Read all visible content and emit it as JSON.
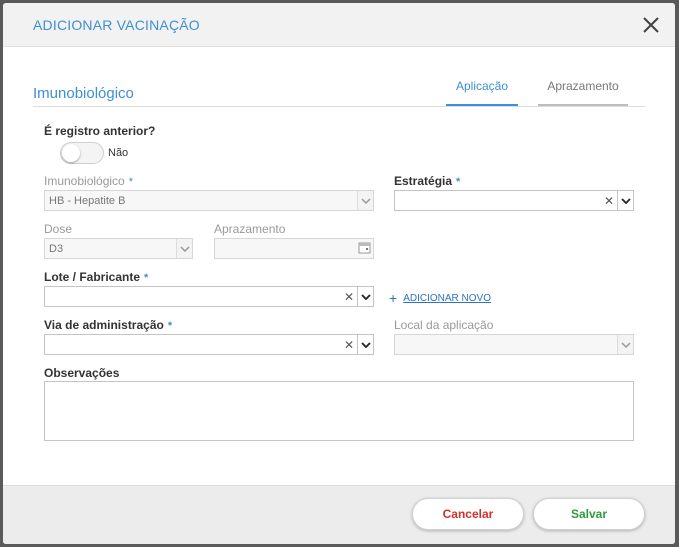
{
  "modal": {
    "title": "ADICIONAR VACINAÇÃO"
  },
  "section": {
    "title": "Imunobiológico"
  },
  "tabs": [
    {
      "label": "Aplicação",
      "active": true
    },
    {
      "label": "Aprazamento",
      "active": false
    }
  ],
  "form": {
    "registro_anterior": {
      "label": "É registro anterior?",
      "toggle_text": "Não",
      "value": false
    },
    "imunobiologico": {
      "label": "Imunobiológico",
      "required_mark": "*",
      "value": "HB - Hepatite B"
    },
    "estrategia": {
      "label": "Estratégia",
      "required_mark": "*",
      "value": ""
    },
    "dose": {
      "label": "Dose",
      "value": "D3"
    },
    "aprazamento": {
      "label": "Aprazamento",
      "value": ""
    },
    "lote": {
      "label": "Lote / Fabricante",
      "required_mark": "*",
      "value": "",
      "add_new": "ADICIONAR NOVO"
    },
    "via": {
      "label": "Via de administração",
      "required_mark": "*",
      "value": ""
    },
    "local": {
      "label": "Local da aplicação",
      "value": ""
    },
    "observacoes": {
      "label": "Observações",
      "value": ""
    }
  },
  "footer": {
    "cancel_label": "Cancelar",
    "save_label": "Salvar"
  },
  "colors": {
    "accent": "#3d8fd6",
    "cancel": "#d0312d",
    "save": "#2f9a3d"
  },
  "icons": {
    "close": "close-icon",
    "dropdown": "chevron-down-icon",
    "calendar": "calendar-icon",
    "plus": "plus-icon",
    "clear": "clear-icon"
  }
}
